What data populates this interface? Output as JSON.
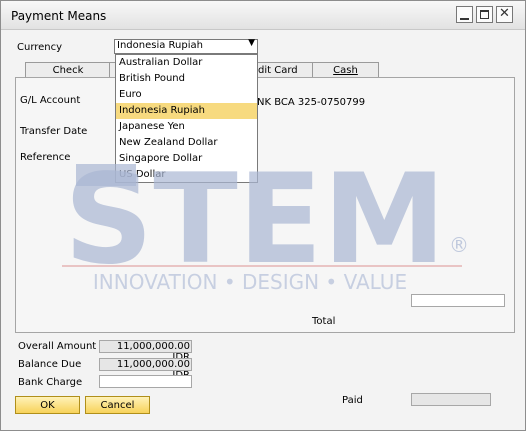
{
  "window": {
    "title": "Payment Means"
  },
  "currency": {
    "label": "Currency",
    "selected": "Indonesia Rupiah",
    "options": [
      "Australian Dollar",
      "British Pound",
      "Euro",
      "Indonesia Rupiah",
      "Japanese Yen",
      "New Zealand Dollar",
      "Singapore Dollar",
      "US Dollar"
    ]
  },
  "tabs": [
    {
      "label": "Check"
    },
    {
      "label": "dit Card"
    },
    {
      "label": "Cash"
    }
  ],
  "form": {
    "gl_account_label": "G/L Account",
    "gl_account_value": "NK BCA 325-0750799",
    "transfer_date_label": "Transfer Date",
    "reference_label": "Reference",
    "total_label": "Total"
  },
  "summary": {
    "overall_amount_label": "Overall Amount",
    "overall_amount_value": "11,000,000.00 IDR",
    "balance_due_label": "Balance Due",
    "balance_due_value": "11,000,000.00 IDR",
    "bank_charge_label": "Bank Charge",
    "paid_label": "Paid"
  },
  "buttons": {
    "ok": "OK",
    "cancel": "Cancel"
  },
  "watermark": {
    "brand": "STEM",
    "tagline": "INNOVATION • DESIGN • VALUE",
    "registered": "®"
  },
  "colors": {
    "accent": "#f7d25a",
    "selection": "#f7da7f",
    "watermark": "#a9b6d3"
  }
}
